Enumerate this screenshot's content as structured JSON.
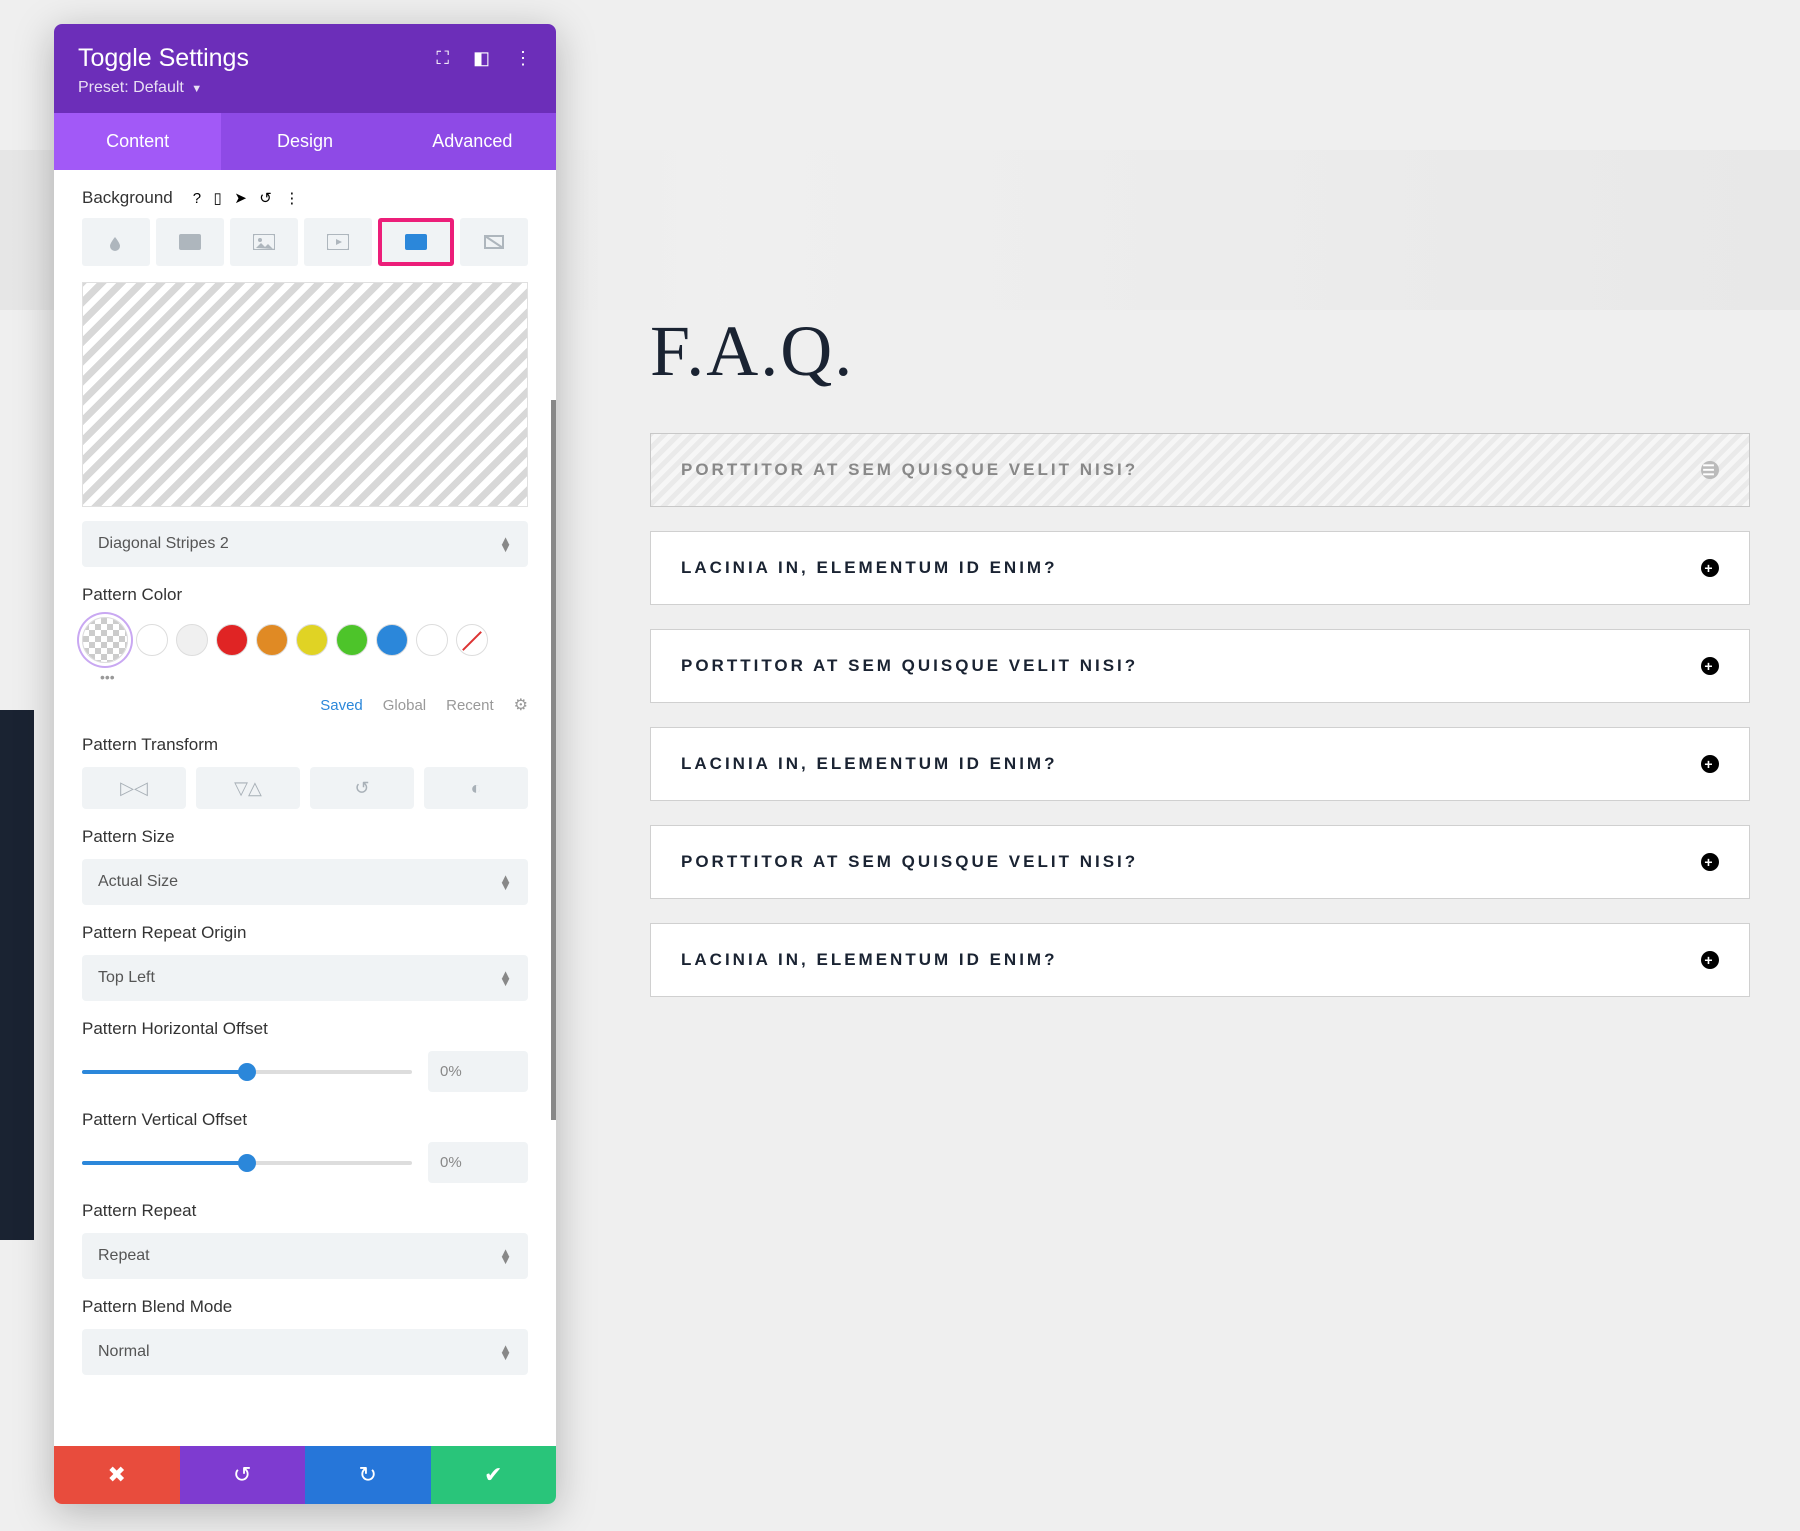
{
  "panel": {
    "title": "Toggle Settings",
    "preset_label": "Preset:",
    "preset_value": "Default",
    "tabs": {
      "content": "Content",
      "design": "Design",
      "advanced": "Advanced"
    },
    "background_label": "Background",
    "pattern_select": "Diagonal Stripes 2",
    "pattern_color_label": "Pattern Color",
    "swatch_meta": {
      "saved": "Saved",
      "global": "Global",
      "recent": "Recent"
    },
    "pattern_transform_label": "Pattern Transform",
    "pattern_size_label": "Pattern Size",
    "pattern_size_value": "Actual Size",
    "pattern_origin_label": "Pattern Repeat Origin",
    "pattern_origin_value": "Top Left",
    "h_offset_label": "Pattern Horizontal Offset",
    "h_offset_value": "0%",
    "v_offset_label": "Pattern Vertical Offset",
    "v_offset_value": "0%",
    "repeat_label": "Pattern Repeat",
    "repeat_value": "Repeat",
    "blend_label": "Pattern Blend Mode",
    "blend_value": "Normal",
    "colors": [
      "#ffffff",
      "#f0f0f0",
      "#e02424",
      "#e08a24",
      "#e0d324",
      "#4dc42a",
      "#2b87da",
      "#ffffff"
    ]
  },
  "faq": {
    "title": "F.A.Q.",
    "items": [
      "PORTTITOR AT SEM QUISQUE VELIT NISI?",
      "LACINIA IN, ELEMENTUM ID ENIM?",
      "PORTTITOR AT SEM QUISQUE VELIT NISI?",
      "LACINIA IN, ELEMENTUM ID ENIM?",
      "PORTTITOR AT SEM QUISQUE VELIT NISI?",
      "LACINIA IN, ELEMENTUM ID ENIM?"
    ]
  }
}
